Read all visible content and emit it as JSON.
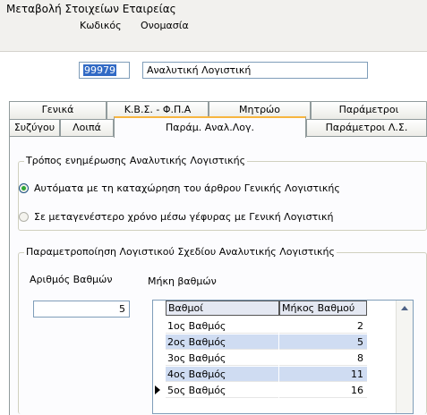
{
  "window": {
    "title": "Μεταβολή Στοιχείων Εταιρείας"
  },
  "company": {
    "code_label": "Κωδικός",
    "name_label": "Ονομασία",
    "code_value": "99979",
    "name_value": "Αναλυτική Λογιστική"
  },
  "tabs_row1": [
    "Γενικά",
    "Κ.Β.Σ. - Φ.Π.Α",
    "Μητρώο",
    "Παράμετροι"
  ],
  "tabs_row2": [
    "Συζύγου",
    "Λοιπά",
    "Παράμ. Αναλ.Λογ.",
    "Παράμετροι Λ.Σ."
  ],
  "active_tab": "Παράμ. Αναλ.Λογ.",
  "update_group": {
    "label": "Τρόπος ενημέρωσης Αναλυτικής Λογιστικής",
    "option_auto": "Αυτόματα με τη καταχώρηση του άρθρου Γενικής Λογιστικής",
    "option_later": "Σε μεταγενέστερο χρόνο μέσω γέφυρας με Γενική Λογιστική",
    "selected": "auto"
  },
  "chart_group": {
    "label": "Παραμετροποίηση Λογιστικού Σχεδίου Αναλυτικής Λογιστικής",
    "levels_label": "Αριθμός Βαθμών",
    "levels_value": "5",
    "lengths_label": "Μήκη βαθμών",
    "columns": [
      "Βαθμοί",
      "Μήκος Βαθμού"
    ],
    "rows": [
      {
        "name": "1ος Βαθμός",
        "length": "2"
      },
      {
        "name": "2ος Βαθμός",
        "length": "5"
      },
      {
        "name": "3ος Βαθμός",
        "length": "8"
      },
      {
        "name": "4ος Βαθμός",
        "length": "11"
      },
      {
        "name": "5ος Βαθμός",
        "length": "16"
      }
    ]
  },
  "colors": {
    "selection": "#316ac5",
    "alt_row": "#cfdcf2",
    "radio_checked": "#2ea735"
  }
}
